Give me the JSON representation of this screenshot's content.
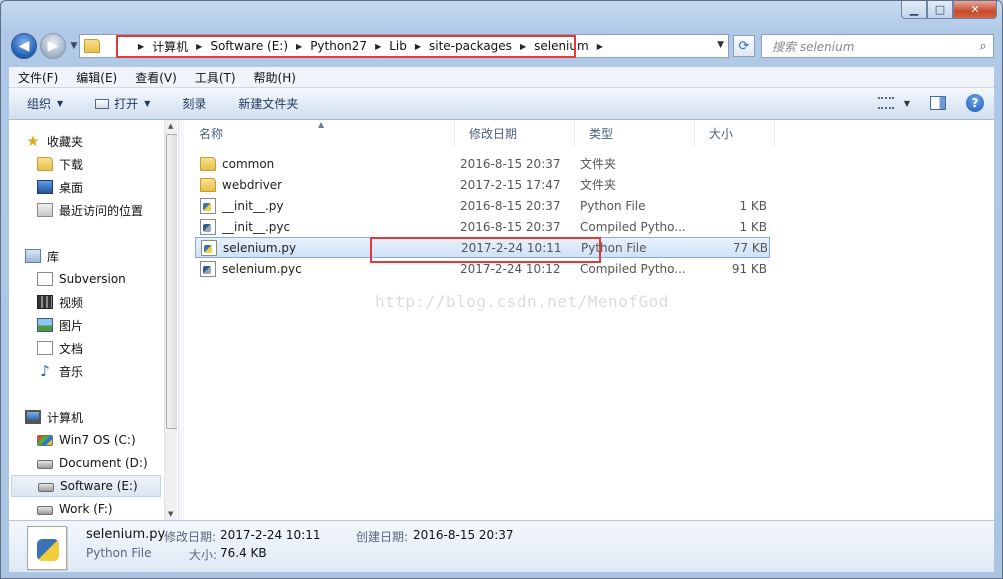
{
  "window": {
    "caption": {
      "minimize": "▁",
      "maximize": "□",
      "close": "✕"
    }
  },
  "nav": {
    "back_glyph": "◀",
    "forward_glyph": "▶",
    "dropdown_glyph": "▼"
  },
  "address": {
    "crumbs": [
      "计算机",
      "Software (E:)",
      "Python27",
      "Lib",
      "site-packages",
      "selenium"
    ]
  },
  "search": {
    "placeholder": "搜索 selenium"
  },
  "menu": [
    "文件(F)",
    "编辑(E)",
    "查看(V)",
    "工具(T)",
    "帮助(H)"
  ],
  "toolbar": {
    "organize": "组织",
    "open": "打开",
    "burn": "刻录",
    "new_folder": "新建文件夹"
  },
  "sidebar": {
    "favorites": {
      "label": "收藏夹",
      "items": [
        "下载",
        "桌面",
        "最近访问的位置"
      ]
    },
    "libraries": {
      "label": "库",
      "items": [
        "Subversion",
        "视频",
        "图片",
        "文档",
        "音乐"
      ]
    },
    "computer": {
      "label": "计算机",
      "items": [
        "Win7 OS (C:)",
        "Document (D:)",
        "Software (E:)",
        "Work (F:)"
      ]
    }
  },
  "columns": {
    "name": "名称",
    "date": "修改日期",
    "type": "类型",
    "size": "大小"
  },
  "files": [
    {
      "name": "common",
      "date": "2016-8-15 20:37",
      "type": "文件夹",
      "size": "",
      "kind": "folder"
    },
    {
      "name": "webdriver",
      "date": "2017-2-15 17:47",
      "type": "文件夹",
      "size": "",
      "kind": "folder"
    },
    {
      "name": "__init__.py",
      "date": "2016-8-15 20:37",
      "type": "Python File",
      "size": "1 KB",
      "kind": "py"
    },
    {
      "name": "__init__.pyc",
      "date": "2016-8-15 20:37",
      "type": "Compiled Pytho...",
      "size": "1 KB",
      "kind": "pyc"
    },
    {
      "name": "selenium.py",
      "date": "2017-2-24 10:11",
      "type": "Python File",
      "size": "77 KB",
      "kind": "py",
      "selected": true
    },
    {
      "name": "selenium.pyc",
      "date": "2017-2-24 10:12",
      "type": "Compiled Pytho...",
      "size": "91 KB",
      "kind": "pyc"
    }
  ],
  "watermark": "http://blog.csdn.net/MenofGod",
  "details": {
    "name": "selenium.py",
    "type": "Python File",
    "modified_label": "修改日期:",
    "modified_value": "2017-2-24 10:11",
    "size_label": "大小:",
    "size_value": "76.4 KB",
    "created_label": "创建日期:",
    "created_value": "2016-8-15 20:37"
  },
  "colors": {
    "highlight_box": "#e23a3a",
    "selection": "#cfe2f7",
    "chrome": "#b0c9e6"
  }
}
